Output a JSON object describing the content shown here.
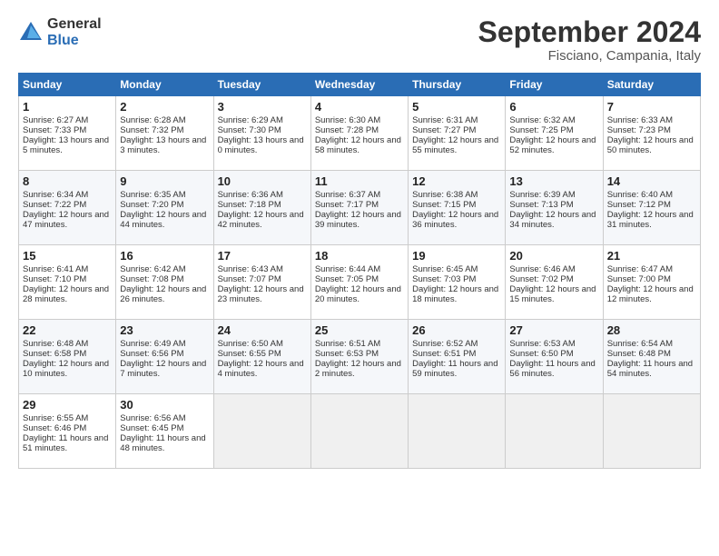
{
  "header": {
    "logo_general": "General",
    "logo_blue": "Blue",
    "title": "September 2024",
    "location": "Fisciano, Campania, Italy"
  },
  "calendar": {
    "days_of_week": [
      "Sunday",
      "Monday",
      "Tuesday",
      "Wednesday",
      "Thursday",
      "Friday",
      "Saturday"
    ],
    "weeks": [
      [
        {
          "day": "",
          "empty": true
        },
        {
          "day": "",
          "empty": true
        },
        {
          "day": "",
          "empty": true
        },
        {
          "day": "",
          "empty": true
        },
        {
          "day": "",
          "empty": true
        },
        {
          "day": "",
          "empty": true
        },
        {
          "day": "",
          "empty": true
        }
      ],
      [
        {
          "day": "1",
          "sunrise": "Sunrise: 6:27 AM",
          "sunset": "Sunset: 7:33 PM",
          "daylight": "Daylight: 13 hours and 5 minutes."
        },
        {
          "day": "2",
          "sunrise": "Sunrise: 6:28 AM",
          "sunset": "Sunset: 7:32 PM",
          "daylight": "Daylight: 13 hours and 3 minutes."
        },
        {
          "day": "3",
          "sunrise": "Sunrise: 6:29 AM",
          "sunset": "Sunset: 7:30 PM",
          "daylight": "Daylight: 13 hours and 0 minutes."
        },
        {
          "day": "4",
          "sunrise": "Sunrise: 6:30 AM",
          "sunset": "Sunset: 7:28 PM",
          "daylight": "Daylight: 12 hours and 58 minutes."
        },
        {
          "day": "5",
          "sunrise": "Sunrise: 6:31 AM",
          "sunset": "Sunset: 7:27 PM",
          "daylight": "Daylight: 12 hours and 55 minutes."
        },
        {
          "day": "6",
          "sunrise": "Sunrise: 6:32 AM",
          "sunset": "Sunset: 7:25 PM",
          "daylight": "Daylight: 12 hours and 52 minutes."
        },
        {
          "day": "7",
          "sunrise": "Sunrise: 6:33 AM",
          "sunset": "Sunset: 7:23 PM",
          "daylight": "Daylight: 12 hours and 50 minutes."
        }
      ],
      [
        {
          "day": "8",
          "sunrise": "Sunrise: 6:34 AM",
          "sunset": "Sunset: 7:22 PM",
          "daylight": "Daylight: 12 hours and 47 minutes."
        },
        {
          "day": "9",
          "sunrise": "Sunrise: 6:35 AM",
          "sunset": "Sunset: 7:20 PM",
          "daylight": "Daylight: 12 hours and 44 minutes."
        },
        {
          "day": "10",
          "sunrise": "Sunrise: 6:36 AM",
          "sunset": "Sunset: 7:18 PM",
          "daylight": "Daylight: 12 hours and 42 minutes."
        },
        {
          "day": "11",
          "sunrise": "Sunrise: 6:37 AM",
          "sunset": "Sunset: 7:17 PM",
          "daylight": "Daylight: 12 hours and 39 minutes."
        },
        {
          "day": "12",
          "sunrise": "Sunrise: 6:38 AM",
          "sunset": "Sunset: 7:15 PM",
          "daylight": "Daylight: 12 hours and 36 minutes."
        },
        {
          "day": "13",
          "sunrise": "Sunrise: 6:39 AM",
          "sunset": "Sunset: 7:13 PM",
          "daylight": "Daylight: 12 hours and 34 minutes."
        },
        {
          "day": "14",
          "sunrise": "Sunrise: 6:40 AM",
          "sunset": "Sunset: 7:12 PM",
          "daylight": "Daylight: 12 hours and 31 minutes."
        }
      ],
      [
        {
          "day": "15",
          "sunrise": "Sunrise: 6:41 AM",
          "sunset": "Sunset: 7:10 PM",
          "daylight": "Daylight: 12 hours and 28 minutes."
        },
        {
          "day": "16",
          "sunrise": "Sunrise: 6:42 AM",
          "sunset": "Sunset: 7:08 PM",
          "daylight": "Daylight: 12 hours and 26 minutes."
        },
        {
          "day": "17",
          "sunrise": "Sunrise: 6:43 AM",
          "sunset": "Sunset: 7:07 PM",
          "daylight": "Daylight: 12 hours and 23 minutes."
        },
        {
          "day": "18",
          "sunrise": "Sunrise: 6:44 AM",
          "sunset": "Sunset: 7:05 PM",
          "daylight": "Daylight: 12 hours and 20 minutes."
        },
        {
          "day": "19",
          "sunrise": "Sunrise: 6:45 AM",
          "sunset": "Sunset: 7:03 PM",
          "daylight": "Daylight: 12 hours and 18 minutes."
        },
        {
          "day": "20",
          "sunrise": "Sunrise: 6:46 AM",
          "sunset": "Sunset: 7:02 PM",
          "daylight": "Daylight: 12 hours and 15 minutes."
        },
        {
          "day": "21",
          "sunrise": "Sunrise: 6:47 AM",
          "sunset": "Sunset: 7:00 PM",
          "daylight": "Daylight: 12 hours and 12 minutes."
        }
      ],
      [
        {
          "day": "22",
          "sunrise": "Sunrise: 6:48 AM",
          "sunset": "Sunset: 6:58 PM",
          "daylight": "Daylight: 12 hours and 10 minutes."
        },
        {
          "day": "23",
          "sunrise": "Sunrise: 6:49 AM",
          "sunset": "Sunset: 6:56 PM",
          "daylight": "Daylight: 12 hours and 7 minutes."
        },
        {
          "day": "24",
          "sunrise": "Sunrise: 6:50 AM",
          "sunset": "Sunset: 6:55 PM",
          "daylight": "Daylight: 12 hours and 4 minutes."
        },
        {
          "day": "25",
          "sunrise": "Sunrise: 6:51 AM",
          "sunset": "Sunset: 6:53 PM",
          "daylight": "Daylight: 12 hours and 2 minutes."
        },
        {
          "day": "26",
          "sunrise": "Sunrise: 6:52 AM",
          "sunset": "Sunset: 6:51 PM",
          "daylight": "Daylight: 11 hours and 59 minutes."
        },
        {
          "day": "27",
          "sunrise": "Sunrise: 6:53 AM",
          "sunset": "Sunset: 6:50 PM",
          "daylight": "Daylight: 11 hours and 56 minutes."
        },
        {
          "day": "28",
          "sunrise": "Sunrise: 6:54 AM",
          "sunset": "Sunset: 6:48 PM",
          "daylight": "Daylight: 11 hours and 54 minutes."
        }
      ],
      [
        {
          "day": "29",
          "sunrise": "Sunrise: 6:55 AM",
          "sunset": "Sunset: 6:46 PM",
          "daylight": "Daylight: 11 hours and 51 minutes."
        },
        {
          "day": "30",
          "sunrise": "Sunrise: 6:56 AM",
          "sunset": "Sunset: 6:45 PM",
          "daylight": "Daylight: 11 hours and 48 minutes."
        },
        {
          "day": "",
          "empty": true
        },
        {
          "day": "",
          "empty": true
        },
        {
          "day": "",
          "empty": true
        },
        {
          "day": "",
          "empty": true
        },
        {
          "day": "",
          "empty": true
        }
      ]
    ]
  }
}
